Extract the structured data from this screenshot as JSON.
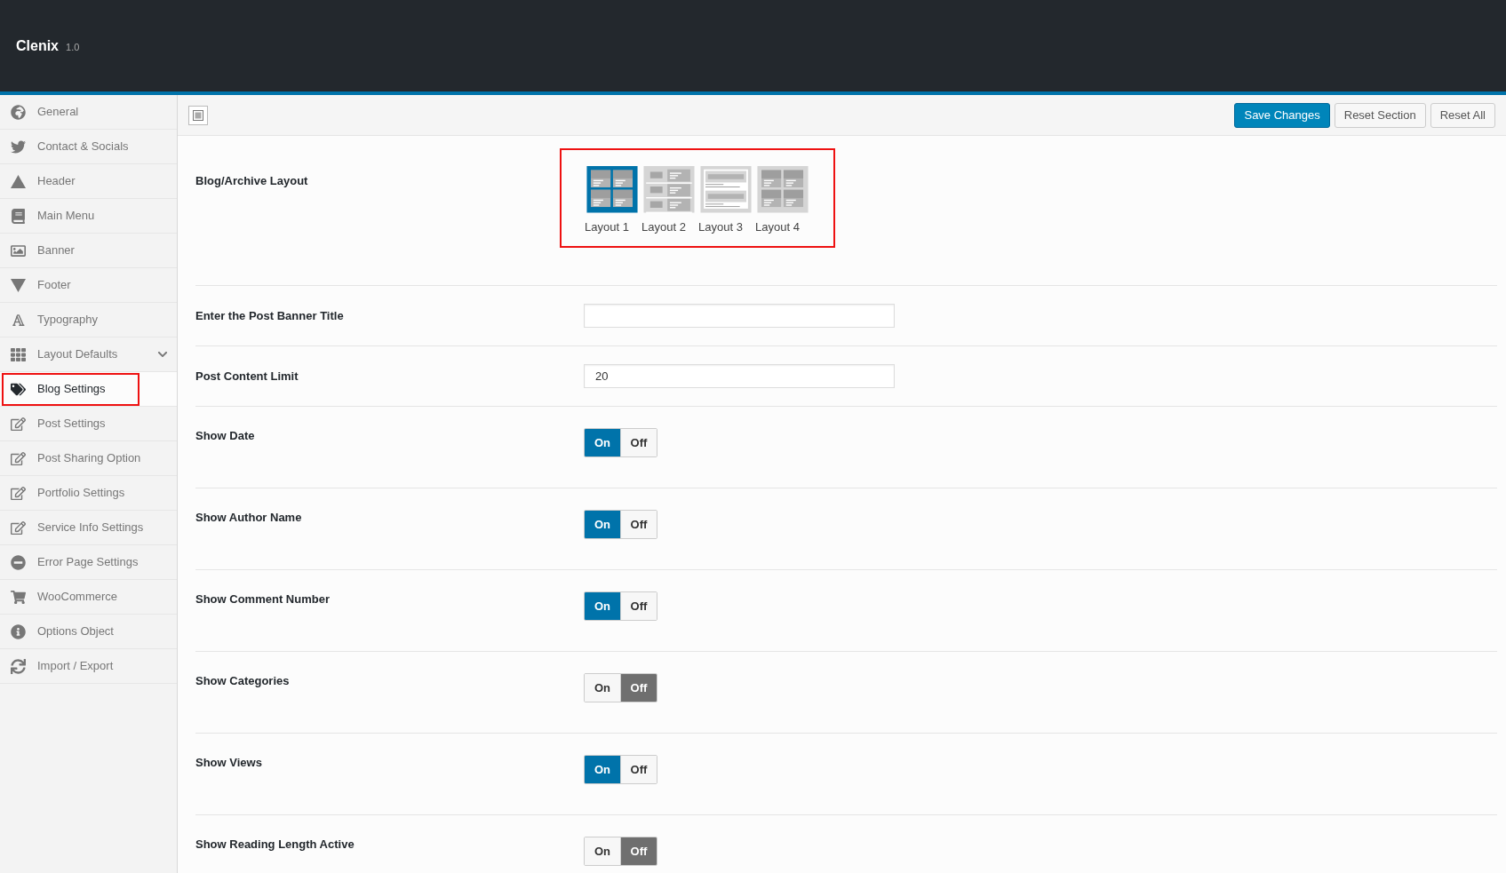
{
  "brand": {
    "name": "Clenix",
    "version": "1.0"
  },
  "sidebar": {
    "items": [
      {
        "label": "General",
        "selected": false,
        "highlighted": false,
        "expandable": false
      },
      {
        "label": "Contact & Socials",
        "selected": false,
        "highlighted": false,
        "expandable": false
      },
      {
        "label": "Header",
        "selected": false,
        "highlighted": false,
        "expandable": false
      },
      {
        "label": "Main Menu",
        "selected": false,
        "highlighted": false,
        "expandable": false
      },
      {
        "label": "Banner",
        "selected": false,
        "highlighted": false,
        "expandable": false
      },
      {
        "label": "Footer",
        "selected": false,
        "highlighted": false,
        "expandable": false
      },
      {
        "label": "Typography",
        "selected": false,
        "highlighted": false,
        "expandable": false
      },
      {
        "label": "Layout Defaults",
        "selected": false,
        "highlighted": false,
        "expandable": true
      },
      {
        "label": "Blog Settings",
        "selected": true,
        "highlighted": true,
        "expandable": false
      },
      {
        "label": "Post Settings",
        "selected": false,
        "highlighted": false,
        "expandable": false
      },
      {
        "label": "Post Sharing Option",
        "selected": false,
        "highlighted": false,
        "expandable": false
      },
      {
        "label": "Portfolio Settings",
        "selected": false,
        "highlighted": false,
        "expandable": false
      },
      {
        "label": "Service Info Settings",
        "selected": false,
        "highlighted": false,
        "expandable": false
      },
      {
        "label": "Error Page Settings",
        "selected": false,
        "highlighted": false,
        "expandable": false
      },
      {
        "label": "WooCommerce",
        "selected": false,
        "highlighted": false,
        "expandable": false
      },
      {
        "label": "Options Object",
        "selected": false,
        "highlighted": false,
        "expandable": false
      },
      {
        "label": "Import / Export",
        "selected": false,
        "highlighted": false,
        "expandable": false
      }
    ]
  },
  "toolbar": {
    "buttons": [
      {
        "label": "Save Changes",
        "primary": true
      },
      {
        "label": "Reset Section",
        "primary": false
      },
      {
        "label": "Reset All",
        "primary": false
      }
    ]
  },
  "fields": [
    {
      "kind": "layouts",
      "label": "Blog/Archive Layout",
      "highlighted": true,
      "options": [
        {
          "label": "Layout 1",
          "selected": true
        },
        {
          "label": "Layout 2",
          "selected": false
        },
        {
          "label": "Layout 3",
          "selected": false
        },
        {
          "label": "Layout 4",
          "selected": false
        }
      ]
    },
    {
      "kind": "text",
      "label": "Enter the Post Banner Title"
    },
    {
      "kind": "text",
      "label": "Post Content Limit",
      "value": "20"
    },
    {
      "kind": "switch",
      "label": "Show Date",
      "on": true,
      "on_label": "On",
      "off_label": "Off"
    },
    {
      "kind": "switch",
      "label": "Show Author Name",
      "on": true,
      "on_label": "On",
      "off_label": "Off"
    },
    {
      "kind": "switch",
      "label": "Show Comment Number",
      "on": true,
      "on_label": "On",
      "off_label": "Off"
    },
    {
      "kind": "switch",
      "label": "Show Categories",
      "on": false,
      "on_label": "On",
      "off_label": "Off"
    },
    {
      "kind": "switch",
      "label": "Show Views",
      "on": true,
      "on_label": "On",
      "off_label": "Off"
    },
    {
      "kind": "switch",
      "label": "Show Reading Length Active",
      "on": false,
      "on_label": "On",
      "off_label": "Off"
    }
  ]
}
